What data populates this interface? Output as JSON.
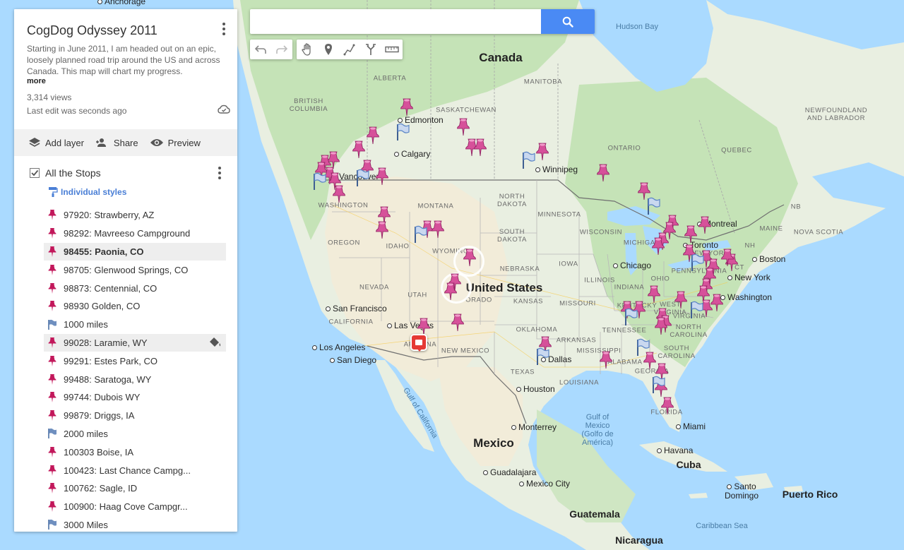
{
  "map": {
    "countries": {
      "canada": "Canada",
      "united_states": "United States",
      "mexico": "Mexico",
      "cuba": "Cuba",
      "guatemala": "Guatemala",
      "nicaragua": "Nicaragua",
      "puerto_rico": "Puerto Rico"
    },
    "regions": {
      "alberta": "ALBERTA",
      "british_columbia": "BRITISH\nCOLUMBIA",
      "saskatchewan": "SASKATCHEWAN",
      "manitoba": "MANITOBA",
      "ontario": "ONTARIO",
      "quebec": "QUEBEC",
      "newfoundland": "NEWFOUNDLAND\nAND LABRADOR",
      "nb": "NB",
      "nova_scotia": "NOVA SCOTIA",
      "washington": "WASHINGTON",
      "oregon": "OREGON",
      "idaho": "IDAHO",
      "montana": "MONTANA",
      "wyoming": "WYOMING",
      "nevada": "NEVADA",
      "utah": "UTAH",
      "california": "CALIFORNIA",
      "arizona": "ARIZONA",
      "new_mexico": "NEW MEXICO",
      "colorado": "ORADO",
      "north_dakota": "NORTH\nDAKOTA",
      "south_dakota": "SOUTH\nDAKOTA",
      "nebraska": "NEBRASKA",
      "kansas": "KANSAS",
      "oklahoma": "OKLAHOMA",
      "texas": "TEXAS",
      "minnesota": "MINNESOTA",
      "iowa": "IOWA",
      "missouri": "MISSOURI",
      "arkansas": "ARKANSAS",
      "louisiana": "LOUISIANA",
      "wisconsin": "WISCONSIN",
      "michigan": "MICHIGAN",
      "illinois": "ILLINOIS",
      "indiana": "INDIANA",
      "ohio": "OHIO",
      "kentucky": "KENTUCKY",
      "tennessee": "TENNESSEE",
      "mississippi": "MISSISSIPPI",
      "alabama": "ALABAMA",
      "georgia": "GEORGIA",
      "florida": "FLORIDA",
      "south_carolina": "SOUTH\nCAROLINA",
      "north_carolina": "NORTH\nCAROLINA",
      "virginia": "VIRGINIA",
      "west_virginia": "WEST\nVIRGINIA",
      "new_york": "NEW YORK",
      "pennsylvania": "PENNSYLVANIA",
      "maine": "MAINE",
      "ct": "CT",
      "nh": "NH"
    },
    "waters": {
      "hudson_bay": "Hudson Bay",
      "gulf_of_mexico": "Gulf of\nMexico\n(Golfo de\nAmérica)",
      "gulf_of_california": "Gulf of California",
      "caribbean_sea": "Caribbean Sea"
    },
    "cities": {
      "anchorage": "Anchorage",
      "edmonton": "Edmonton",
      "calgary": "Calgary",
      "vancouver": "Vancouver",
      "winnipeg": "Winnipeg",
      "montreal": "Montreal",
      "toronto": "Toronto",
      "boston": "Boston",
      "new_york": "New York",
      "washington": "Washington",
      "chicago": "Chicago",
      "san_francisco": "San Francisco",
      "las_vegas": "Las Vegas",
      "los_angeles": "Los Angeles",
      "san_diego": "San Diego",
      "dallas": "Dallas",
      "houston": "Houston",
      "monterrey": "Monterrey",
      "guadalajara": "Guadalajara",
      "mexico_city": "Mexico City",
      "miami": "Miami",
      "havana": "Havana",
      "santo_domingo": "Santo\nDomingo"
    },
    "colors": {
      "water": "#aadaff",
      "land": "#e9efe1",
      "land_green": "#bfe0b0",
      "desert": "#f1ead8",
      "border": "#707070",
      "state_border": "#b3b3b3",
      "pin": "#d6519a",
      "flag": "#5c86c6",
      "poi": "#e53935"
    }
  },
  "search": {
    "placeholder": "",
    "value": ""
  },
  "toolbar": {
    "buttons": [
      {
        "name": "undo-icon"
      },
      {
        "name": "redo-icon"
      },
      {
        "name": "hand-icon"
      },
      {
        "name": "marker-icon"
      },
      {
        "name": "draw-line-icon"
      },
      {
        "name": "directions-icon"
      },
      {
        "name": "ruler-icon"
      }
    ]
  },
  "panel": {
    "title": "CogDog Odyssey 2011",
    "description": "Starting in June 2011, I am headed out on an epic, loosely planned road trip around the US and across Canada. This map will chart my progress.",
    "more": "more",
    "views": "3,314 views",
    "last_edit": "Last edit was seconds ago",
    "actions": {
      "add_layer": "Add layer",
      "share": "Share",
      "preview": "Preview"
    },
    "layer": {
      "title": "All the Stops",
      "style": "Individual styles",
      "items": [
        {
          "label": "97920: Strawberry, AZ",
          "icon": "pin"
        },
        {
          "label": "98292: Mavreeso Campground",
          "icon": "pin"
        },
        {
          "label": "98455: Paonia, CO",
          "icon": "pin"
        },
        {
          "label": "98705: Glenwood Springs, CO",
          "icon": "pin"
        },
        {
          "label": "98873: Centennial, CO",
          "icon": "pin"
        },
        {
          "label": "98930 Golden, CO",
          "icon": "pin"
        },
        {
          "label": "1000 miles",
          "icon": "flag"
        },
        {
          "label": "99028: Laramie, WY",
          "icon": "pin"
        },
        {
          "label": "99291: Estes Park, CO",
          "icon": "pin"
        },
        {
          "label": "99488: Saratoga, WY",
          "icon": "pin"
        },
        {
          "label": "99744: Dubois WY",
          "icon": "pin"
        },
        {
          "label": "99879: Driggs, IA",
          "icon": "pin"
        },
        {
          "label": "2000 miles",
          "icon": "flag"
        },
        {
          "label": "100303 Boise, IA",
          "icon": "pin"
        },
        {
          "label": "100423: Last Chance Campg...",
          "icon": "pin"
        },
        {
          "label": "100762: Sagle, ID",
          "icon": "pin"
        },
        {
          "label": "100900: Haag Cove Campgr...",
          "icon": "pin"
        },
        {
          "label": "3000 Miles",
          "icon": "flag"
        }
      ]
    }
  }
}
